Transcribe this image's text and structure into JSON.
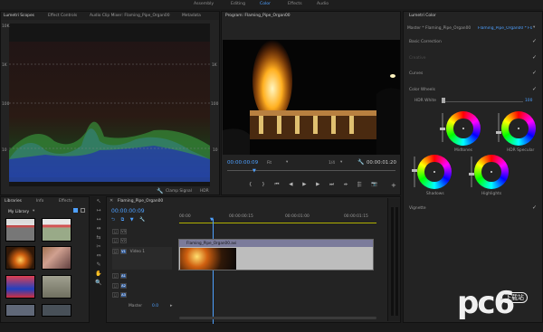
{
  "workspaces": [
    "Assembly",
    "Editing",
    "Color",
    "Effects",
    "Audio"
  ],
  "active_workspace": "Color",
  "left_tabs": [
    "Lumetri Scopes",
    "Effect Controls",
    "Audio Clip Mixer: Flaming_Pipe_Organ00",
    "Metadata"
  ],
  "scopes": {
    "y_labels": [
      "10K",
      "1K",
      "100",
      "10"
    ],
    "right_labels": [
      "1K",
      "100",
      "10"
    ],
    "clamp_label": "Clamp Signal",
    "mode": "HDR"
  },
  "program": {
    "title": "Program: Flaming_Pipe_Organ00",
    "timecode_left": "00:00:00:09",
    "fit": "Fit",
    "resolution": "1/4",
    "timecode_right": "00:00:01:20"
  },
  "lumetri": {
    "title": "Lumetri Color",
    "master": "Master * Flaming_Pipe_Organ00",
    "clip": "Flaming_Pipe_Organ00 * Flaming_Pipe_Organ00",
    "sections": [
      "Basic Correction",
      "Creative",
      "Curves",
      "Color Wheels"
    ],
    "hdr_label": "HDR White",
    "hdr_value": "100",
    "wheels": [
      "Midtones",
      "HDR Specular",
      "Shadows",
      "Highlights"
    ],
    "vignette": "Vignette"
  },
  "library": {
    "tabs": [
      "Libraries",
      "Info",
      "Effects"
    ],
    "name": "My Library"
  },
  "timeline": {
    "title": "Flaming_Pipe_Organ00",
    "timecode": "00:00:00:09",
    "ruler": [
      "00:00",
      "00:00:00:15",
      "00:00:01:00",
      "00:00:01:15"
    ],
    "tracks": [
      "V3",
      "V2",
      "V1",
      "A1",
      "A2",
      "A3"
    ],
    "v1_label": "Video 1",
    "clip_name": "Flaming_Pipe_Organ00.avi",
    "master_label": "Master",
    "master_value": "0.0"
  },
  "watermark": {
    "brand": "pc6",
    "subtitle": "下载站"
  }
}
